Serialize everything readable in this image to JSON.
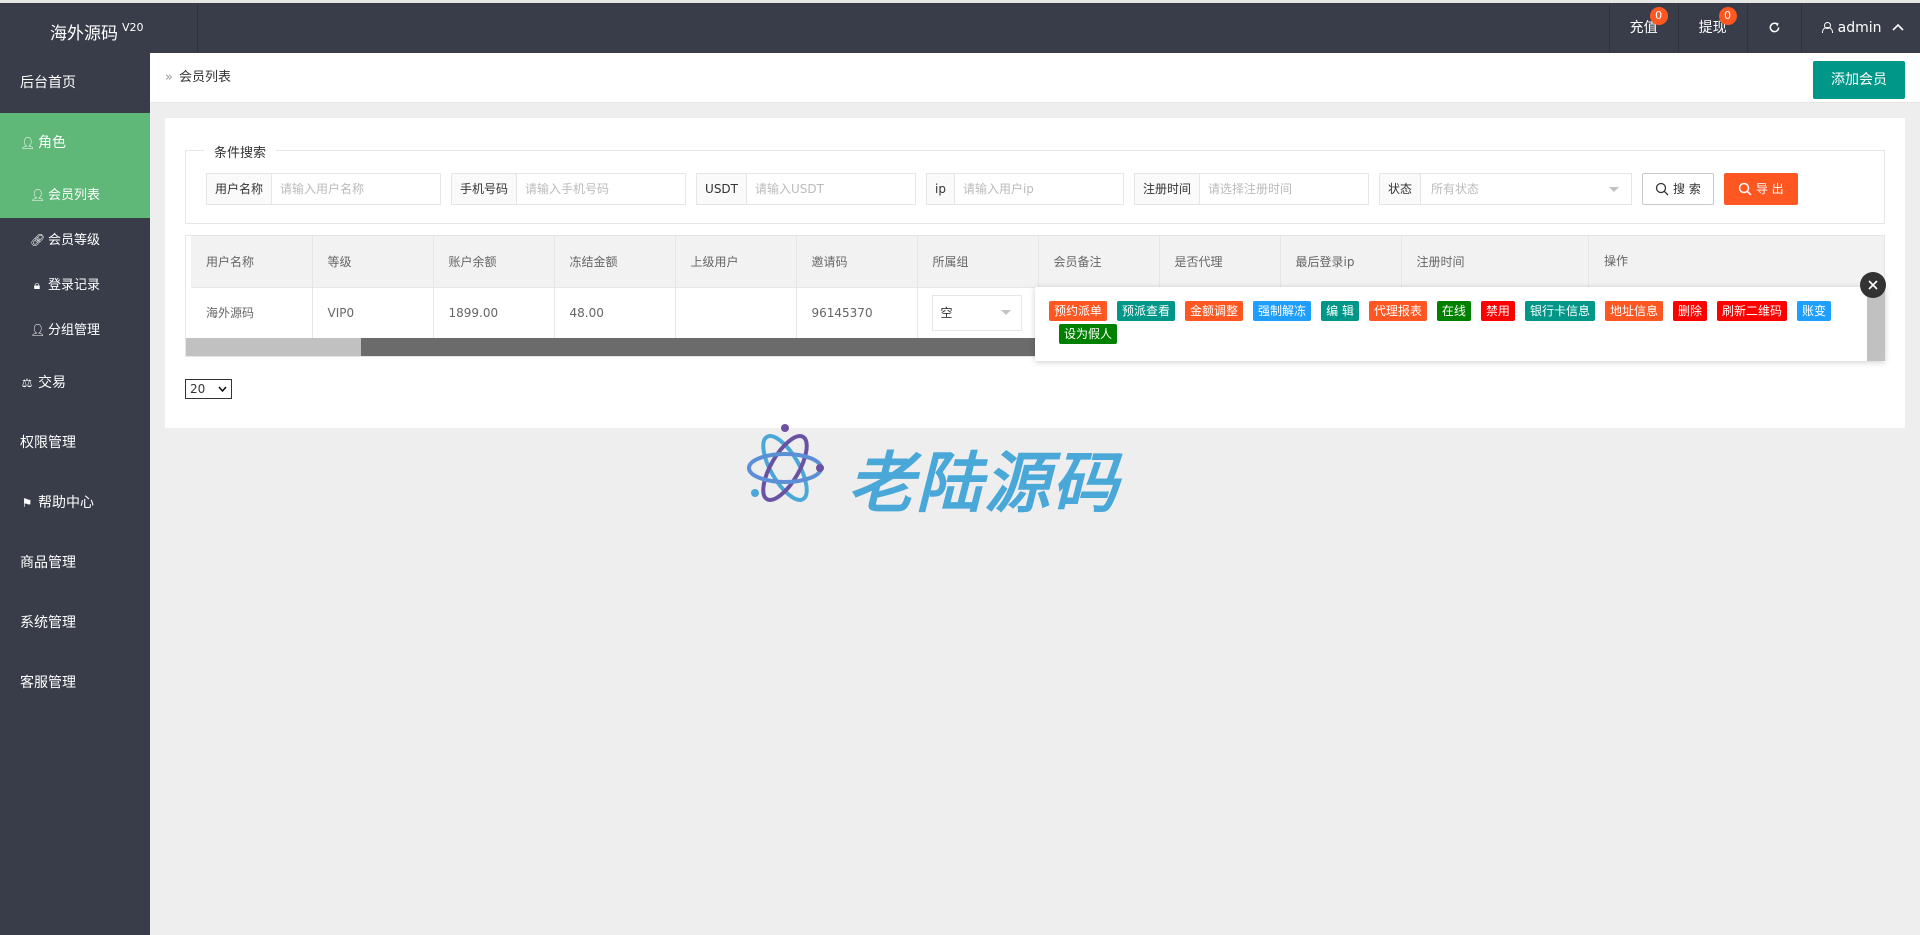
{
  "app": {
    "title": "海外源码",
    "version": "V20"
  },
  "topbar": {
    "recharge": {
      "label": "充值",
      "badge": "0"
    },
    "withdraw": {
      "label": "提现",
      "badge": "0"
    },
    "refresh_icon": "refresh-icon",
    "user": "admin"
  },
  "sidebar": {
    "items": [
      {
        "label": "后台首页"
      },
      {
        "label": "角色",
        "icon": "user-icon",
        "active": true
      },
      {
        "label": "交易",
        "icon": "scale-icon"
      },
      {
        "label": "权限管理"
      },
      {
        "label": "帮助中心",
        "icon": "flag-icon"
      },
      {
        "label": "商品管理"
      },
      {
        "label": "系统管理"
      },
      {
        "label": "客服管理"
      }
    ],
    "sub_items": [
      {
        "label": "会员列表",
        "icon": "user-icon",
        "active": true
      },
      {
        "label": "会员等级",
        "icon": "link-icon"
      },
      {
        "label": "登录记录",
        "icon": "lock-icon"
      },
      {
        "label": "分组管理",
        "icon": "user-icon"
      }
    ]
  },
  "breadcrumb": {
    "text": "会员列表"
  },
  "add_button": "添加会员",
  "search": {
    "legend": "条件搜索",
    "username": {
      "label": "用户名称",
      "placeholder": "请输入用户名称"
    },
    "phone": {
      "label": "手机号码",
      "placeholder": "请输入手机号码"
    },
    "usdt": {
      "label": "USDT",
      "placeholder": "请输入USDT"
    },
    "ip": {
      "label": "ip",
      "placeholder": "请输入用户ip"
    },
    "reg_time": {
      "label": "注册时间",
      "placeholder": "请选择注册时间"
    },
    "status": {
      "label": "状态",
      "value": "所有状态"
    },
    "search_button": "搜 索",
    "export_button": "导 出"
  },
  "table": {
    "columns": [
      "用户名称",
      "等级",
      "账户余额",
      "冻结金额",
      "上级用户",
      "邀请码",
      "所属组",
      "会员备注",
      "是否代理",
      "最后登录ip",
      "注册时间",
      "操作"
    ],
    "rows": [
      {
        "username": "海外源码",
        "level": "VIP0",
        "balance": "1899.00",
        "frozen": "48.00",
        "parent": "",
        "invite_code": "96145370",
        "group": "空"
      }
    ]
  },
  "actions": [
    {
      "label": "预约派单",
      "color": "#ff5722"
    },
    {
      "label": "预派查看",
      "color": "#009688"
    },
    {
      "label": "金额调整",
      "color": "#ff5722"
    },
    {
      "label": "强制解冻",
      "color": "#1e9fff"
    },
    {
      "label": "编 辑",
      "color": "#009688"
    },
    {
      "label": "代理报表",
      "color": "#ff5722"
    },
    {
      "label": "在线",
      "color": "#008000"
    },
    {
      "label": "禁用",
      "color": "#ff0000"
    },
    {
      "label": "银行卡信息",
      "color": "#009688"
    },
    {
      "label": "地址信息",
      "color": "#ff5722"
    },
    {
      "label": "删除",
      "color": "#ff0000"
    },
    {
      "label": "刷新二维码",
      "color": "#ff0000"
    },
    {
      "label": "账变",
      "color": "#1e9fff"
    },
    {
      "label": "设为假人",
      "color": "#008000"
    }
  ],
  "pager": {
    "page_size": "20"
  },
  "watermark": {
    "text": "老陆源码"
  }
}
